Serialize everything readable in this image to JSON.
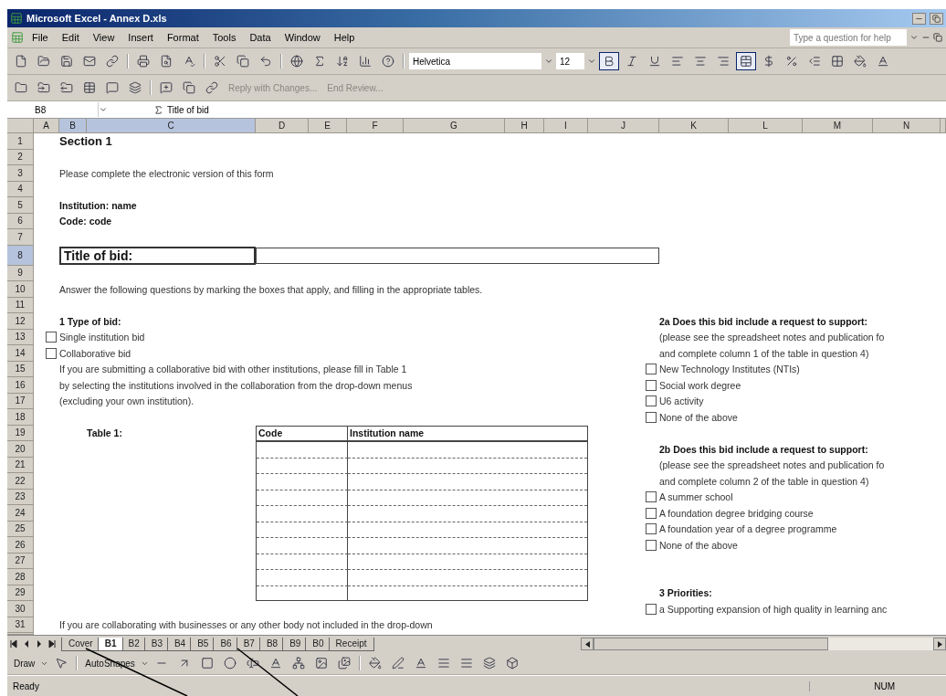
{
  "window": {
    "title": "Microsoft Excel - Annex D.xls"
  },
  "menu": [
    "File",
    "Edit",
    "View",
    "Insert",
    "Format",
    "Tools",
    "Data",
    "Window",
    "Help"
  ],
  "help_box": {
    "placeholder": "Type a question for help"
  },
  "format_toolbar": {
    "font": "Helvetica",
    "size": "12",
    "buttons": [
      {
        "kind": "bold",
        "selected": true
      },
      {
        "kind": "italic",
        "selected": false
      },
      {
        "kind": "underline",
        "selected": false
      },
      {
        "kind": "align_left",
        "selected": false
      },
      {
        "kind": "center",
        "selected": false
      },
      {
        "kind": "align_right",
        "selected": false
      },
      {
        "kind": "merge_center",
        "selected": true
      },
      {
        "kind": "currency",
        "selected": false
      },
      {
        "kind": "percent",
        "selected": false
      },
      {
        "kind": "indent",
        "selected": false
      }
    ]
  },
  "review_toolbar": {
    "reply": "Reply with Changes...",
    "end_review": "End Review..."
  },
  "formula_bar": {
    "name_box": "B8",
    "formula": "Title of bid"
  },
  "columns": [
    {
      "label": "A",
      "selected": false
    },
    {
      "label": "B",
      "selected": true
    },
    {
      "label": "C",
      "selected": true
    },
    {
      "label": "D",
      "selected": false
    },
    {
      "label": "E",
      "selected": false
    },
    {
      "label": "F",
      "selected": false
    },
    {
      "label": "G",
      "selected": false
    },
    {
      "label": "H",
      "selected": false
    },
    {
      "label": "I",
      "selected": false
    },
    {
      "label": "J",
      "selected": false
    },
    {
      "label": "K",
      "selected": false
    },
    {
      "label": "L",
      "selected": false
    },
    {
      "label": "M",
      "selected": false
    },
    {
      "label": "N",
      "selected": false
    }
  ],
  "rows": [
    {
      "label": "1",
      "selected": false
    },
    {
      "label": "2",
      "selected": false
    },
    {
      "label": "3",
      "selected": false
    },
    {
      "label": "4",
      "selected": false
    },
    {
      "label": "5",
      "selected": false
    },
    {
      "label": "6",
      "selected": false
    },
    {
      "label": "7",
      "selected": false
    },
    {
      "label": "8",
      "selected": true
    },
    {
      "label": "9",
      "selected": false
    },
    {
      "label": "10",
      "selected": false
    },
    {
      "label": "11",
      "selected": false
    },
    {
      "label": "12",
      "selected": false
    },
    {
      "label": "13",
      "selected": false
    },
    {
      "label": "14",
      "selected": false
    },
    {
      "label": "15",
      "selected": false
    },
    {
      "label": "16",
      "selected": false
    },
    {
      "label": "17",
      "selected": false
    },
    {
      "label": "18",
      "selected": false
    },
    {
      "label": "19",
      "selected": false
    },
    {
      "label": "20",
      "selected": false
    },
    {
      "label": "21",
      "selected": false
    },
    {
      "label": "22",
      "selected": false
    },
    {
      "label": "23",
      "selected": false
    },
    {
      "label": "24",
      "selected": false
    },
    {
      "label": "25",
      "selected": false
    },
    {
      "label": "26",
      "selected": false
    },
    {
      "label": "27",
      "selected": false
    },
    {
      "label": "28",
      "selected": false
    },
    {
      "label": "29",
      "selected": false
    },
    {
      "label": "30",
      "selected": false
    },
    {
      "label": "31",
      "selected": false
    }
  ],
  "sheet": {
    "heading": "Section 1",
    "intro": "Please complete the electronic version of this form",
    "institution": "Institution: name",
    "code": "Code: code",
    "title_label": "Title of bid:",
    "instructions": "Answer the following questions by marking the boxes that apply, and filling in the appropriate tables.",
    "question_1": {
      "title": "1 Type of bid:",
      "options": [
        {
          "label": "Single institution bid",
          "checked": false
        },
        {
          "label": "Collaborative bid",
          "checked": false
        }
      ],
      "notes": [
        "If you are submitting a collaborative bid with other institutions, please fill in Table 1",
        "by selecting the institutions involved in the collaboration from the drop-down menus",
        "(excluding your own institution)."
      ]
    },
    "table_1": {
      "label": "Table 1:",
      "columns": [
        "Code",
        "Institution name"
      ]
    },
    "question_2a": {
      "title": "2a Does this bid include a request to support:",
      "notes": [
        "(please see the spreadsheet notes and publication fo",
        "and complete column 1 of the table in question 4)"
      ],
      "options": [
        {
          "label": "New Technology Institutes (NTIs)",
          "checked": false
        },
        {
          "label": "Social work degree",
          "checked": false
        },
        {
          "label": "U6 activity",
          "checked": false
        },
        {
          "label": "None of the above",
          "checked": false
        }
      ]
    },
    "question_2b": {
      "title": "2b Does this bid include a request to support:",
      "notes": [
        "(please see the spreadsheet notes and publication fo",
        "and complete column 2 of the table in question 4)"
      ],
      "options": [
        {
          "label": "A summer school",
          "checked": false
        },
        {
          "label": "A foundation degree bridging course",
          "checked": false
        },
        {
          "label": "A foundation year of a degree programme",
          "checked": false
        },
        {
          "label": "None of the above",
          "checked": false
        }
      ]
    },
    "question_3": {
      "title": "3 Priorities:",
      "options": [
        {
          "label": "a Supporting expansion of high quality in learning anc",
          "checked": false
        }
      ]
    },
    "footer_note": "If you are collaborating with businesses or any other body not included in the drop-down"
  },
  "sheet_tabs": [
    {
      "label": "Cover",
      "selected": false
    },
    {
      "label": "B1",
      "selected": true
    },
    {
      "label": "B2",
      "selected": false
    },
    {
      "label": "B3",
      "selected": false
    },
    {
      "label": "B4",
      "selected": false
    },
    {
      "label": "B5",
      "selected": false
    },
    {
      "label": "B6",
      "selected": false
    },
    {
      "label": "B7",
      "selected": false
    },
    {
      "label": "B8",
      "selected": false
    },
    {
      "label": "B9",
      "selected": false
    },
    {
      "label": "B0",
      "selected": false
    },
    {
      "label": "Receipt",
      "selected": false
    }
  ],
  "drawing_toolbar": {
    "draw": "Draw",
    "autoshapes": "AutoShapes"
  },
  "status_bar": {
    "status": "Ready",
    "num": "NUM"
  }
}
